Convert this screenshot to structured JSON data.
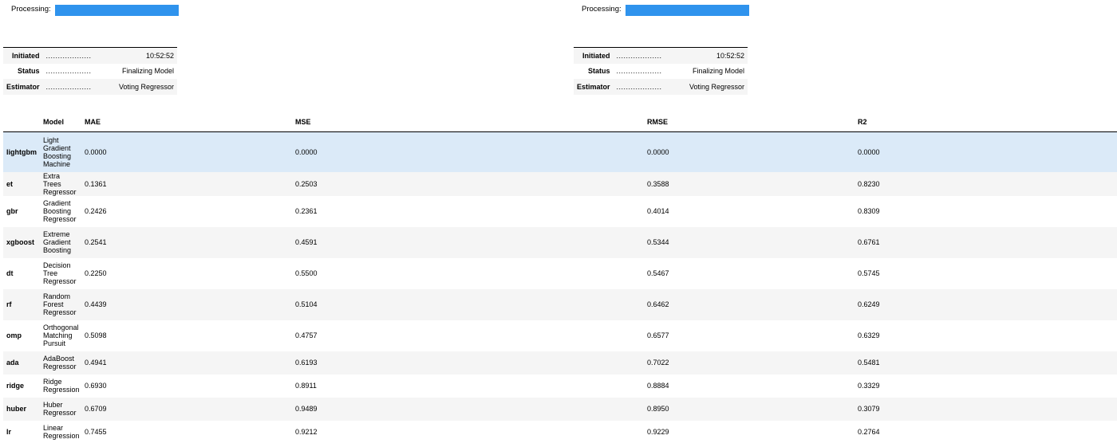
{
  "panels": [
    {
      "processing_label": "Processing:",
      "progress": 1.0,
      "info": [
        {
          "key": "Initiated",
          "dots": "...................",
          "value": "10:52:52"
        },
        {
          "key": "Status",
          "dots": "...................",
          "value": "Finalizing Model"
        },
        {
          "key": "Estimator",
          "dots": "...................",
          "value": "Voting Regressor"
        }
      ]
    },
    {
      "processing_label": "Processing:",
      "progress": 1.0,
      "info": [
        {
          "key": "Initiated",
          "dots": "...................",
          "value": "10:52:52"
        },
        {
          "key": "Status",
          "dots": "...................",
          "value": "Finalizing Model"
        },
        {
          "key": "Estimator",
          "dots": "...................",
          "value": "Voting Regressor"
        }
      ]
    }
  ],
  "colors": {
    "progress": "#2f93ed",
    "highlight": "#dbeaf8",
    "stripe": "#f5f5f5"
  },
  "table": {
    "headers": [
      "",
      "Model",
      "MAE",
      "MSE",
      "RMSE",
      "R2"
    ],
    "rows": [
      {
        "id": "lightgbm",
        "model": "Light Gradient Boosting Machine",
        "mae": "0.0000",
        "mse": "0.0000",
        "rmse": "0.0000",
        "r2": "0.0000",
        "highlight": true
      },
      {
        "id": "et",
        "model": "Extra Trees Regressor",
        "mae": "0.1361",
        "mse": "0.2503",
        "rmse": "0.3588",
        "r2": "0.8230"
      },
      {
        "id": "gbr",
        "model": "Gradient Boosting Regressor",
        "mae": "0.2426",
        "mse": "0.2361",
        "rmse": "0.4014",
        "r2": "0.8309"
      },
      {
        "id": "xgboost",
        "model": "Extreme Gradient Boosting",
        "mae": "0.2541",
        "mse": "0.4591",
        "rmse": "0.5344",
        "r2": "0.6761"
      },
      {
        "id": "dt",
        "model": "Decision Tree Regressor",
        "mae": "0.2250",
        "mse": "0.5500",
        "rmse": "0.5467",
        "r2": "0.5745"
      },
      {
        "id": "rf",
        "model": "Random Forest Regressor",
        "mae": "0.4439",
        "mse": "0.5104",
        "rmse": "0.6462",
        "r2": "0.6249"
      },
      {
        "id": "omp",
        "model": "Orthogonal Matching Pursuit",
        "mae": "0.5098",
        "mse": "0.4757",
        "rmse": "0.6577",
        "r2": "0.6329"
      },
      {
        "id": "ada",
        "model": "AdaBoost Regressor",
        "mae": "0.4941",
        "mse": "0.6193",
        "rmse": "0.7022",
        "r2": "0.5481"
      },
      {
        "id": "ridge",
        "model": "Ridge Regression",
        "mae": "0.6930",
        "mse": "0.8911",
        "rmse": "0.8884",
        "r2": "0.3329"
      },
      {
        "id": "huber",
        "model": "Huber Regressor",
        "mae": "0.6709",
        "mse": "0.9489",
        "rmse": "0.8950",
        "r2": "0.3079"
      },
      {
        "id": "lr",
        "model": "Linear Regression",
        "mae": "0.7455",
        "mse": "0.9212",
        "rmse": "0.9229",
        "r2": "0.2764"
      }
    ]
  }
}
